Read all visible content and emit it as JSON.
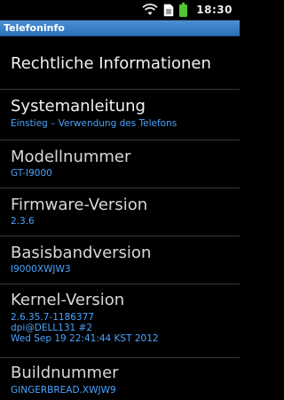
{
  "statusbar": {
    "time": "18:30",
    "icons": [
      "wifi-icon",
      "sim-icon",
      "battery-icon"
    ],
    "battery_color": "#55c533"
  },
  "titlebar": {
    "title": "Telefoninfo",
    "color": "#3a80cc"
  },
  "items": {
    "rechtliche": {
      "label": "Rechtliche Informationen"
    },
    "system": {
      "label": "Systemanleitung",
      "value": "Einstieg – Verwendung des Telefons"
    },
    "modell": {
      "label": "Modellnummer",
      "value": "GT-I9000"
    },
    "firmware": {
      "label": "Firmware-Version",
      "value": "2.3.6"
    },
    "baseband": {
      "label": "Basisbandversion",
      "value": "I9000XWJW3"
    },
    "kernel": {
      "label": "Kernel-Version",
      "lines": [
        "2.6.35.7-1186377",
        "dpi@DELL131 #2",
        "Wed Sep 19 22:41:44 KST 2012"
      ]
    },
    "build": {
      "label": "Buildnummer",
      "value": "GINGERBREAD.XWJW9"
    }
  },
  "colors": {
    "value_text": "#4aa3ff",
    "background": "#000000"
  }
}
